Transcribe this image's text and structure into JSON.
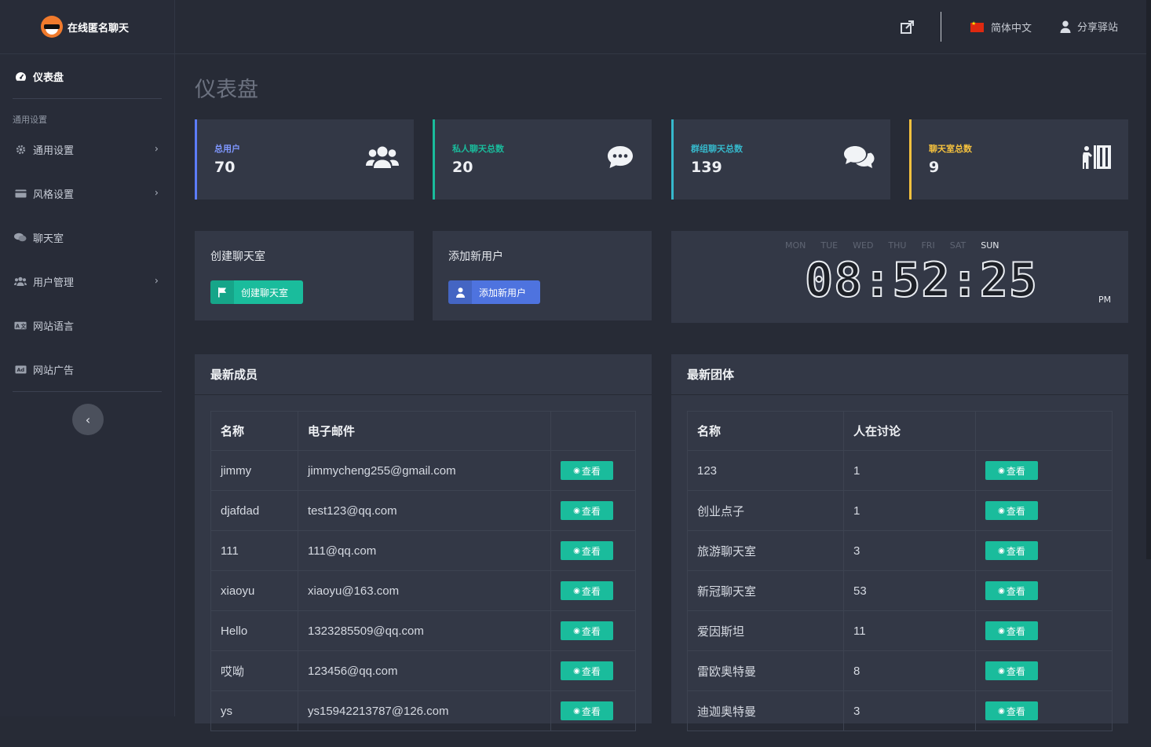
{
  "brand": {
    "name": "在线匿名聊天"
  },
  "topbar": {
    "language": "简体中文",
    "share": "分享驿站"
  },
  "sidebar": {
    "dashboard": "仪表盘",
    "section": "通用设置",
    "items": [
      {
        "label": "通用设置",
        "icon": "gear-icon",
        "chevron": true
      },
      {
        "label": "风格设置",
        "icon": "card-icon",
        "chevron": true
      },
      {
        "label": "聊天室",
        "icon": "chat-icon",
        "chevron": false
      },
      {
        "label": "用户管理",
        "icon": "users-icon",
        "chevron": true
      },
      {
        "label": "网站语言",
        "icon": "language-icon",
        "chevron": false
      },
      {
        "label": "网站广告",
        "icon": "ad-icon",
        "chevron": false
      }
    ]
  },
  "page": {
    "title": "仪表盘"
  },
  "stats": [
    {
      "label": "总用户",
      "value": "70",
      "color": "#5c7cfa",
      "icon": "users-icon"
    },
    {
      "label": "私人聊天总数",
      "value": "20",
      "color": "#1abc9c",
      "icon": "comment-dots-icon"
    },
    {
      "label": "群组聊天总数",
      "value": "139",
      "color": "#36b9cc",
      "icon": "comments-icon"
    },
    {
      "label": "聊天室总数",
      "value": "9",
      "color": "#f6c23e",
      "icon": "door-icon"
    }
  ],
  "actions": {
    "create_room": {
      "title": "创建聊天室",
      "button": "创建聊天室",
      "color": "#1abc9c"
    },
    "add_user": {
      "title": "添加新用户",
      "button": "添加新用户",
      "color": "#4e73df"
    }
  },
  "clock": {
    "days": [
      "MON",
      "TUE",
      "WED",
      "THU",
      "FRI",
      "SAT",
      "SUN"
    ],
    "active_day": "SUN",
    "time": "08:52:25",
    "ampm": "PM"
  },
  "members": {
    "title": "最新成员",
    "columns": [
      "名称",
      "电子邮件",
      ""
    ],
    "view_label": "查看",
    "rows": [
      {
        "name": "jimmy",
        "email": "jimmycheng255@gmail.com"
      },
      {
        "name": "djafdad",
        "email": "test123@qq.com"
      },
      {
        "name": "111",
        "email": "111@qq.com"
      },
      {
        "name": "xiaoyu",
        "email": "xiaoyu@163.com"
      },
      {
        "name": "Hello",
        "email": "1323285509@qq.com"
      },
      {
        "name": "哎呦",
        "email": "123456@qq.com"
      },
      {
        "name": "ys",
        "email": "ys15942213787@126.com"
      }
    ]
  },
  "groups": {
    "title": "最新团体",
    "columns": [
      "名称",
      "人在讨论",
      ""
    ],
    "view_label": "查看",
    "rows": [
      {
        "name": "123",
        "count": "1"
      },
      {
        "name": "创业点子",
        "count": "1"
      },
      {
        "name": "旅游聊天室",
        "count": "3"
      },
      {
        "name": "新冠聊天室",
        "count": "53"
      },
      {
        "name": "爱因斯坦",
        "count": "11"
      },
      {
        "name": "雷欧奥特曼",
        "count": "8"
      },
      {
        "name": "迪迦奥特曼",
        "count": "3"
      }
    ]
  }
}
